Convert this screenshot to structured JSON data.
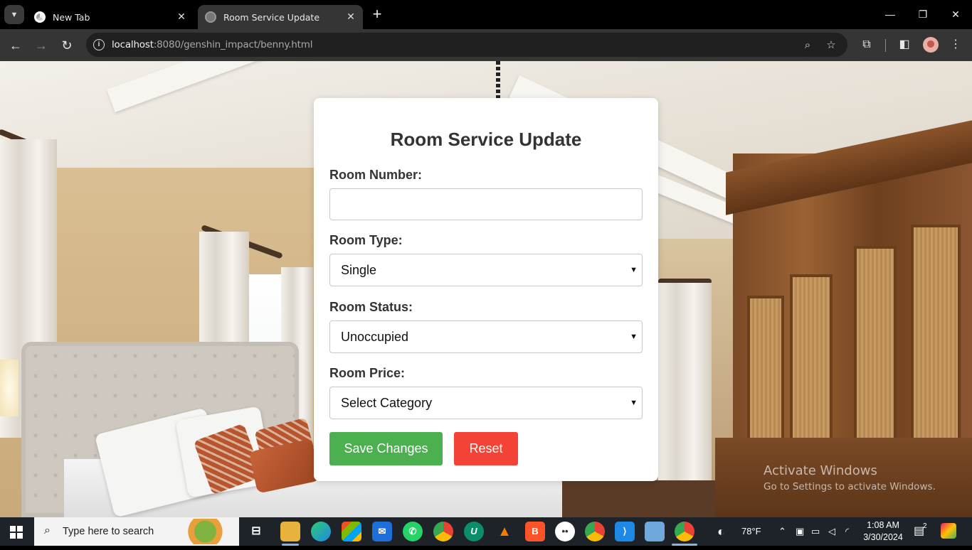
{
  "browser": {
    "tabs": [
      {
        "title": "New Tab",
        "active": false
      },
      {
        "title": "Room Service Update",
        "active": true
      }
    ],
    "url_host": "localhost",
    "url_rest": ":8080/genshin_impact/benny.html"
  },
  "form": {
    "heading": "Room Service Update",
    "room_number_label": "Room Number:",
    "room_number_value": "",
    "room_type_label": "Room Type:",
    "room_type_value": "Single",
    "room_status_label": "Room Status:",
    "room_status_value": "Unoccupied",
    "room_price_label": "Room Price:",
    "room_price_value": "Select Category",
    "save_label": "Save Changes",
    "reset_label": "Reset",
    "save_color": "#4caf50",
    "reset_color": "#f44336"
  },
  "watermark": {
    "title": "Activate Windows",
    "subtitle": "Go to Settings to activate Windows."
  },
  "taskbar": {
    "search_placeholder": "Type here to search",
    "weather": "78°F",
    "time": "1:08 AM",
    "date": "3/30/2024",
    "notification_count": "2"
  }
}
